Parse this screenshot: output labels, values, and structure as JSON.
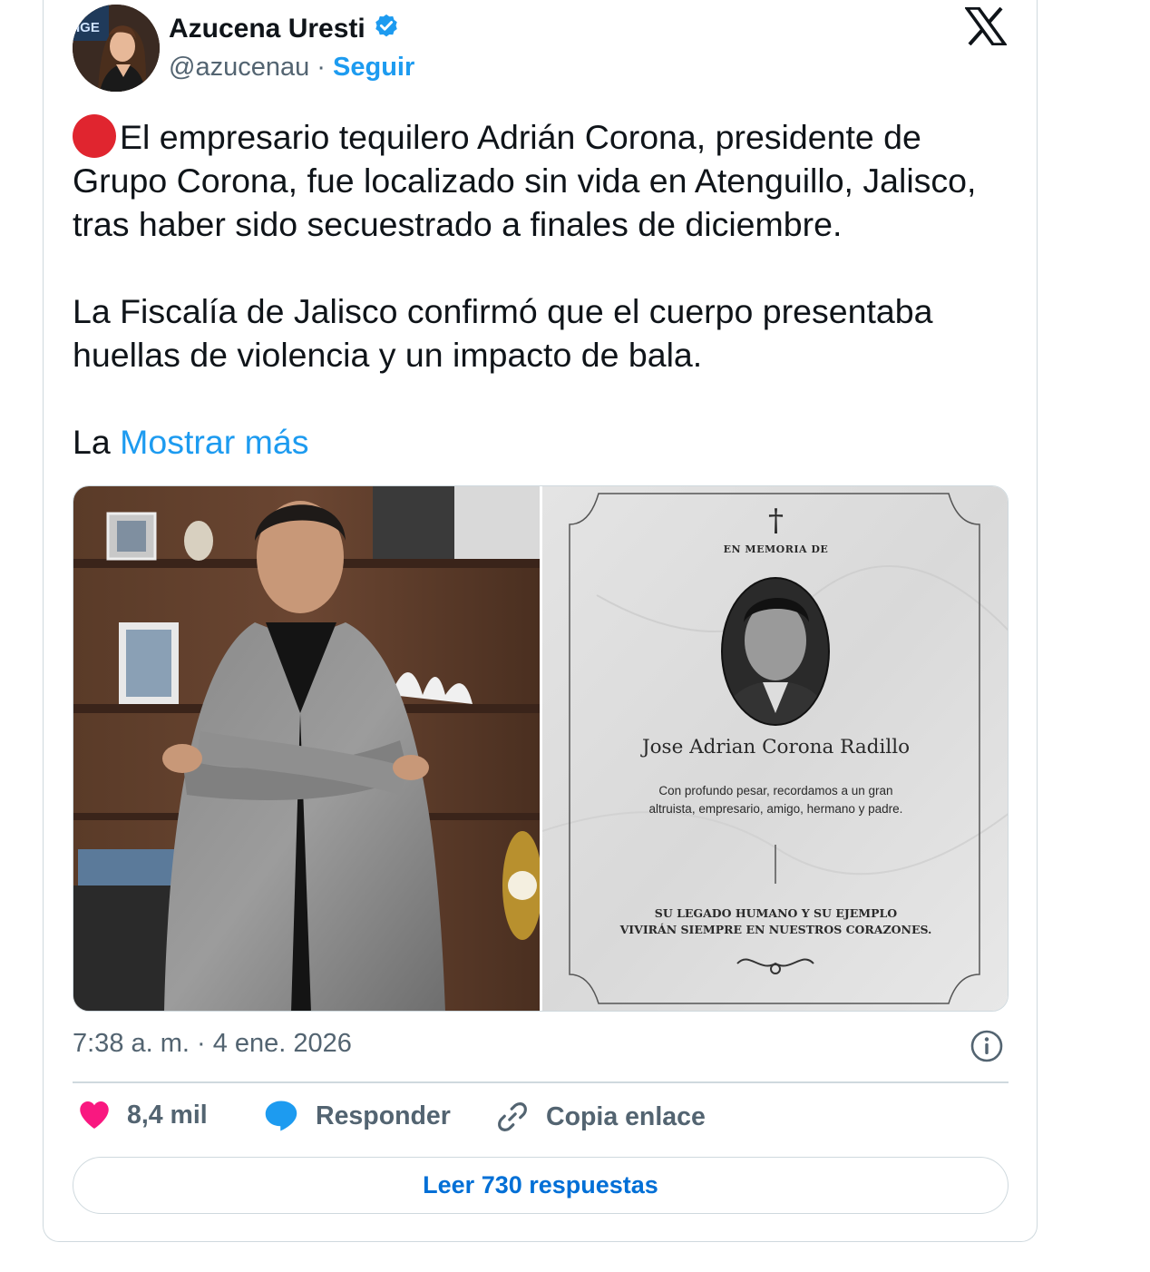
{
  "author": {
    "name": "Azucena Uresti",
    "handle": "@azucenau",
    "separator": "·",
    "follow_label": "Seguir",
    "verified_color": "#1d9bf0"
  },
  "tweet": {
    "paragraph1": "El empresario tequilero Adrián Corona, presidente de Grupo Corona, fue localizado sin vida en Atenguillo, Jalisco, tras haber sido secuestrado a finales de diciembre.",
    "paragraph2": "La Fiscalía de Jalisco confirmó que el cuerpo presentaba huellas de violencia y un impacto de bala.",
    "paragraph3_start": "La",
    "show_more_label": "Mostrar más",
    "emoji_icon": "red-circle-icon"
  },
  "media": {
    "memorial": {
      "cross": "†",
      "in_memory": "EN MEMORIA DE",
      "name": "Jose Adrian Corona Radillo",
      "message_line1": "Con profundo pesar, recordamos a un gran",
      "message_line2": "altruista, empresario, amigo, hermano y padre.",
      "legacy_line1": "SU LEGADO HUMANO Y SU EJEMPLO",
      "legacy_line2": "VIVIRÁN SIEMPRE EN NUESTROS CORAZONES."
    }
  },
  "timestamp": "7:38 a. m. · 4 ene. 2026",
  "actions": {
    "likes": "8,4 mil",
    "reply_label": "Responder",
    "copy_link_label": "Copia enlace",
    "like_color": "#f91880",
    "reply_color": "#1d9bf0"
  },
  "read_replies_label": "Leer 730 respuestas"
}
